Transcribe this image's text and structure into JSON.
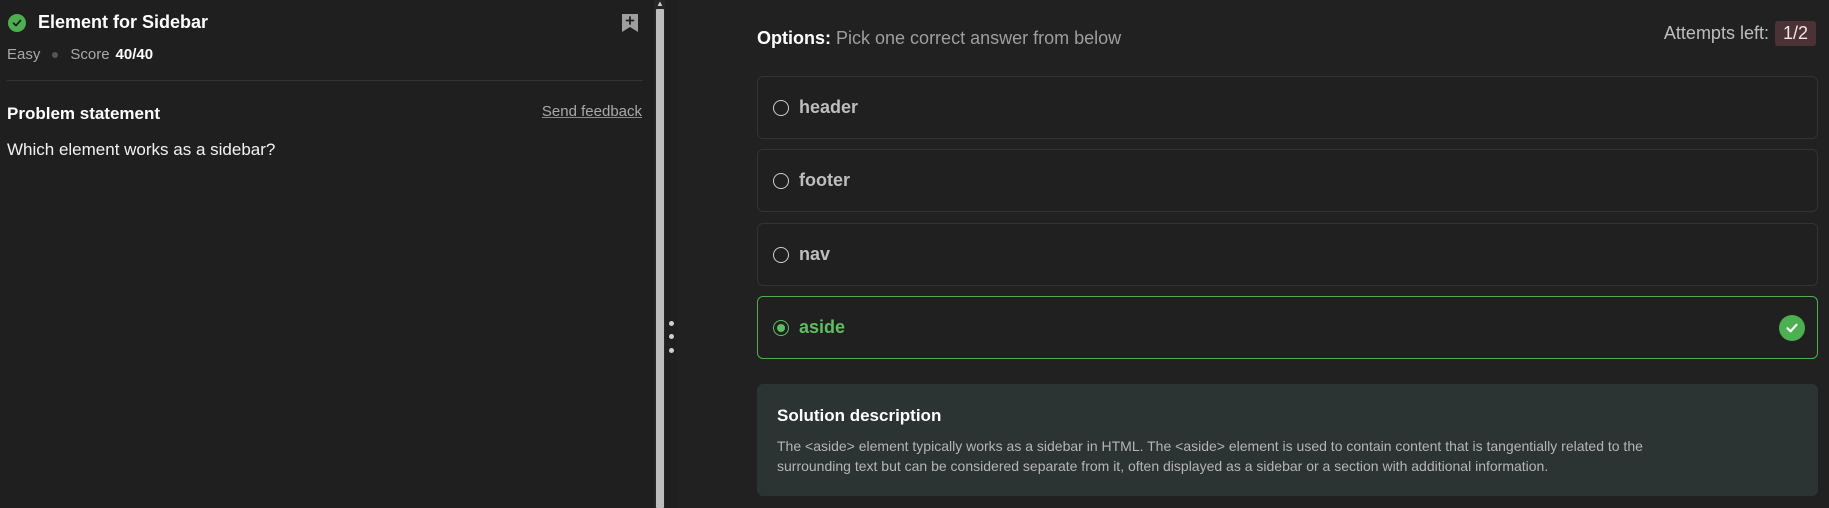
{
  "problem": {
    "title": "Element for Sidebar",
    "difficulty": "Easy",
    "score_label": "Score",
    "score_value": "40/40",
    "statement_heading": "Problem statement",
    "feedback_link": "Send feedback",
    "question": "Which element works as a sidebar?"
  },
  "options_panel": {
    "label": "Options:",
    "hint": "Pick one correct answer from below",
    "attempts_label": "Attempts left:",
    "attempts_value": "1/2",
    "options": [
      {
        "label": "header",
        "selected": false,
        "correct": false
      },
      {
        "label": "footer",
        "selected": false,
        "correct": false
      },
      {
        "label": "nav",
        "selected": false,
        "correct": false
      },
      {
        "label": "aside",
        "selected": true,
        "correct": true
      }
    ]
  },
  "solution": {
    "heading": "Solution description",
    "text_line1": "The <aside> element typically works as a sidebar in HTML. The <aside> element is used to contain content that is tangentially related to the",
    "text_line2": "surrounding text but can be considered separate from it, often displayed as a sidebar or a section with additional information."
  },
  "icons": {
    "status": "check-circle-icon",
    "bookmark": "bookmark-add-icon",
    "correct": "check-circle-icon"
  },
  "colors": {
    "success": "#4caf50",
    "badge_bg": "#4a3236",
    "solution_bg": "#2c3333"
  }
}
